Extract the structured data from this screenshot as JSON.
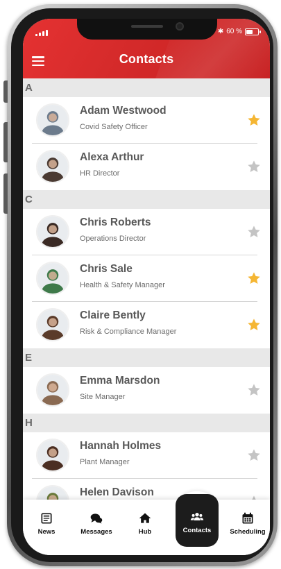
{
  "status_bar": {
    "battery_text": "60 %",
    "battery_level": 0.6
  },
  "header": {
    "title": "Contacts"
  },
  "sections": [
    {
      "letter": "A",
      "contacts": [
        {
          "name": "Adam Westwood",
          "role": "Covid Safety Officer",
          "favorite": true,
          "avatar_color": "#6c7b8c"
        },
        {
          "name": "Alexa Arthur",
          "role": "HR Director",
          "favorite": false,
          "avatar_color": "#4a3a32"
        }
      ]
    },
    {
      "letter": "C",
      "contacts": [
        {
          "name": "Chris Roberts",
          "role": "Operations Director",
          "favorite": false,
          "avatar_color": "#3a2a24"
        },
        {
          "name": "Chris Sale",
          "role": "Health & Safety Manager",
          "favorite": true,
          "avatar_color": "#3f7a4a"
        },
        {
          "name": "Claire Bently",
          "role": "Risk & Compliance Manager",
          "favorite": true,
          "avatar_color": "#5a3b2a"
        }
      ]
    },
    {
      "letter": "E",
      "contacts": [
        {
          "name": "Emma Marsdon",
          "role": "Site Manager",
          "favorite": false,
          "avatar_color": "#8a6a52"
        }
      ]
    },
    {
      "letter": "H",
      "contacts": [
        {
          "name": "Hannah Holmes",
          "role": "Plant Manager",
          "favorite": false,
          "avatar_color": "#4a2e22"
        },
        {
          "name": "Helen Davison",
          "role": "",
          "favorite": false,
          "avatar_color": "#6a7a3a"
        }
      ]
    }
  ],
  "colors": {
    "brand_red": "#d42a2a",
    "star_active": "#f5b633",
    "star_inactive": "#c4c4c4",
    "nav_active_bg": "#1c1c1c"
  },
  "bottom_nav": [
    {
      "label": "News",
      "icon": "newspaper-icon",
      "active": false
    },
    {
      "label": "Messages",
      "icon": "chat-bubbles-icon",
      "active": false
    },
    {
      "label": "Hub",
      "icon": "home-icon",
      "active": false
    },
    {
      "label": "Contacts",
      "icon": "people-icon",
      "active": true
    },
    {
      "label": "Scheduling",
      "icon": "calendar-icon",
      "active": false
    }
  ]
}
